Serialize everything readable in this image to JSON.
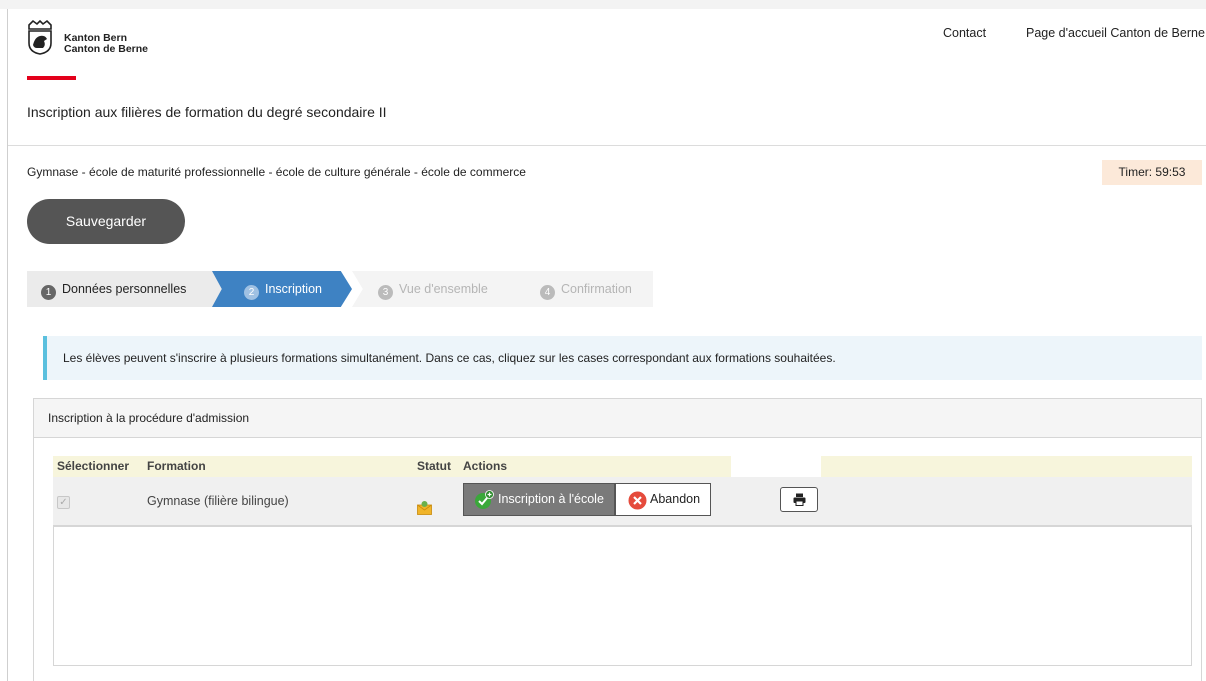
{
  "header": {
    "brand_line1": "Kanton Bern",
    "brand_line2": "Canton de Berne",
    "links": {
      "contact": "Contact",
      "home": "Page d'accueil Canton de Berne"
    }
  },
  "page": {
    "title": "Inscription aux filières de formation du degré secondaire II",
    "subtitle": "Gymnase - école de maturité professionnelle - école de culture générale - école de commerce",
    "timer": "Timer: 59:53",
    "save_label": "Sauvegarder"
  },
  "steps": [
    {
      "num": "1",
      "label": "Données personnelles",
      "state": "completed"
    },
    {
      "num": "2",
      "label": "Inscription",
      "state": "active"
    },
    {
      "num": "3",
      "label": "Vue d'ensemble",
      "state": "disabled"
    },
    {
      "num": "4",
      "label": "Confirmation",
      "state": "disabled"
    }
  ],
  "info": "Les élèves peuvent s'inscrire à plusieurs formations simultanément. Dans ce cas, cliquez sur les cases correspondant aux formations souhaitées.",
  "panel": {
    "title": "Inscription à la procédure d'admission",
    "columns": {
      "select": "Sélectionner",
      "formation": "Formation",
      "status": "Statut",
      "actions": "Actions"
    },
    "rows": [
      {
        "selected": true,
        "formation": "Gymnase (filière bilingue)",
        "status_icon": "envelope-icon",
        "action_primary": "Inscription à l'école",
        "action_secondary": "Abandon"
      }
    ]
  },
  "colors": {
    "accent_blue": "#3e82c3",
    "brand_red": "#e3001b",
    "info_border": "#5bc0de",
    "timer_bg": "#fce9d9"
  }
}
